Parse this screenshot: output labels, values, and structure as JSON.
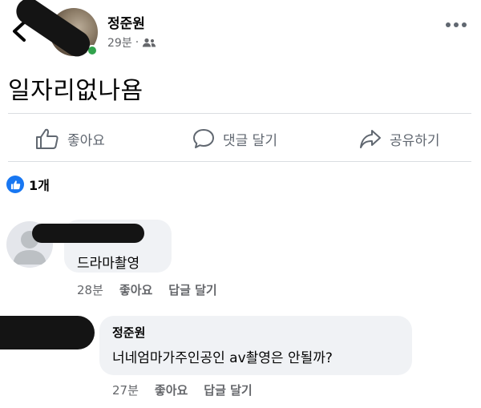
{
  "post": {
    "author_name": "정준원",
    "time": "29분",
    "separator": "·",
    "text": "일자리없나욤"
  },
  "actions": {
    "like_label": "좋아요",
    "comment_label": "댓글 달기",
    "share_label": "공유하기"
  },
  "reactions": {
    "count_label": "1개"
  },
  "comments": [
    {
      "text": "드라마촬영",
      "time": "28분",
      "like_label": "좋아요",
      "reply_label": "답글 달기"
    },
    {
      "author": "정준원",
      "text": "너네엄마가주인공인 av촬영은 안될까?",
      "time": "27분",
      "like_label": "좋아요",
      "reply_label": "답글 달기"
    }
  ],
  "icons": {
    "back": "chevron-left-icon",
    "more": "more-horizontal-icon",
    "audience": "friends-icon",
    "like": "thumbs-up-icon",
    "comment": "speech-bubble-icon",
    "share": "share-arrow-icon"
  },
  "colors": {
    "accent": "#1877f2",
    "online": "#31a24c",
    "muted_text": "#65676b",
    "bubble": "#f0f2f5"
  }
}
